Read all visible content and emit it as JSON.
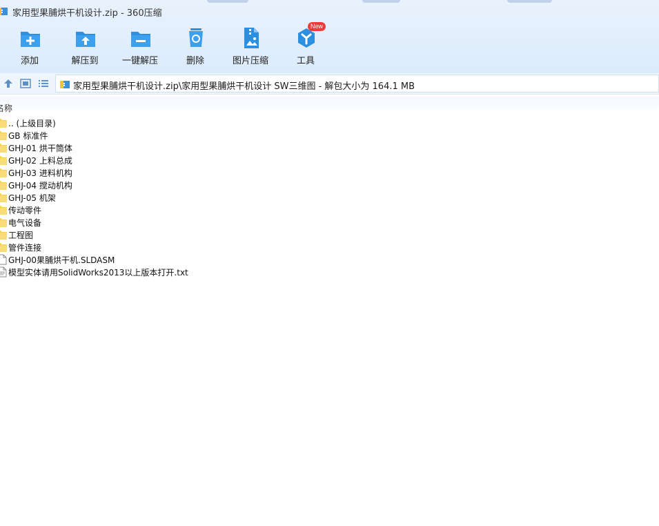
{
  "window": {
    "title": "家用型果脯烘干机设计.zip - 360压缩"
  },
  "toolbar": {
    "items": [
      {
        "label": "添加",
        "icon": "add-folder-icon"
      },
      {
        "label": "解压到",
        "icon": "extract-to-icon"
      },
      {
        "label": "一键解压",
        "icon": "one-click-extract-icon"
      },
      {
        "label": "删除",
        "icon": "delete-icon"
      },
      {
        "label": "图片压缩",
        "icon": "image-compress-icon"
      },
      {
        "label": "工具",
        "icon": "tools-icon",
        "badge": "New"
      }
    ]
  },
  "address_bar": {
    "path": "家用型果脯烘干机设计.zip\\家用型果脯烘干机设计 SW三维图 - 解包大小为 164.1 MB"
  },
  "list": {
    "column_name": "名称",
    "items": [
      {
        "name": ".. (上级目录)",
        "type": "folder"
      },
      {
        "name": "GB 标准件",
        "type": "folder"
      },
      {
        "name": "GHJ-01 烘干筒体",
        "type": "folder"
      },
      {
        "name": "GHJ-02 上料总成",
        "type": "folder"
      },
      {
        "name": "GHJ-03 进料机构",
        "type": "folder"
      },
      {
        "name": "GHJ-04 搅动机构",
        "type": "folder"
      },
      {
        "name": "GHJ-05 机架",
        "type": "folder"
      },
      {
        "name": "传动零件",
        "type": "folder"
      },
      {
        "name": "电气设备",
        "type": "folder"
      },
      {
        "name": "工程图",
        "type": "folder"
      },
      {
        "name": "管件连接",
        "type": "folder"
      },
      {
        "name": "GHJ-00果脯烘干机.SLDASM",
        "type": "file"
      },
      {
        "name": "模型实体请用SolidWorks2013以上版本打开.txt",
        "type": "file"
      }
    ]
  },
  "colors": {
    "toolbar_bg": "#e3eefb",
    "icon_blue": "#2d8fe0",
    "folder_yellow": "#f6cf57",
    "badge_red": "#f23a3a"
  }
}
